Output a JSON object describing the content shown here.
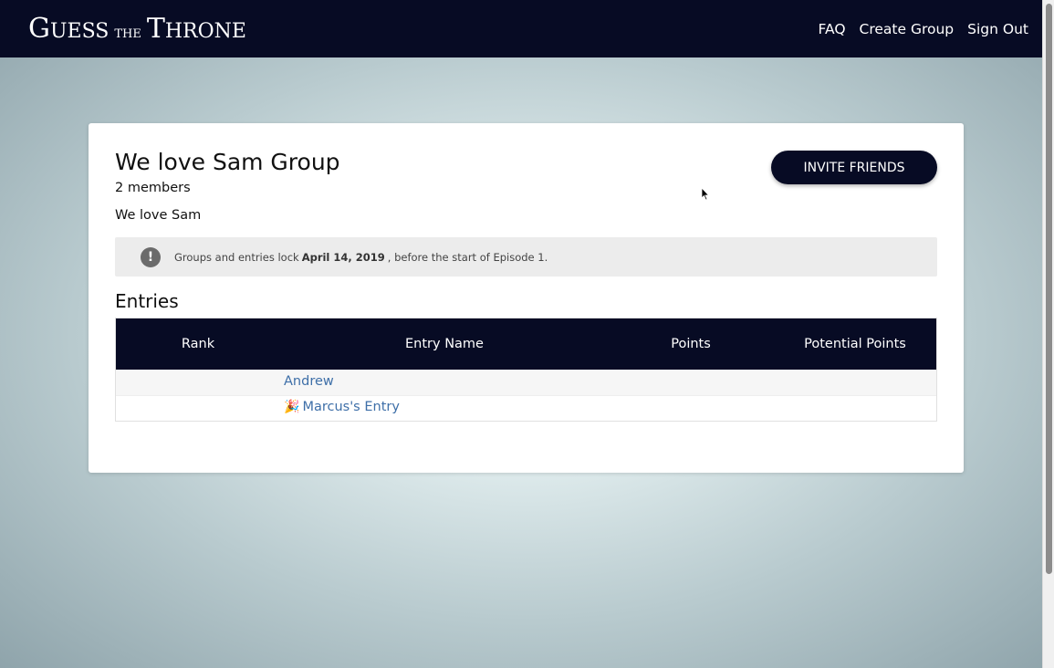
{
  "nav": {
    "logo": {
      "g": "G",
      "uess": "UESS",
      "the": "THE",
      "t": "T",
      "hrone": "HRONE"
    },
    "links": [
      "FAQ",
      "Create Group",
      "Sign Out"
    ]
  },
  "group": {
    "title": "We love Sam Group",
    "members": "2 members",
    "description": "We love Sam",
    "invite_label": "INVITE FRIENDS"
  },
  "notice": {
    "prefix": "Groups and entries lock",
    "date": "April 14, 2019",
    "suffix": ", before the start of Episode 1.",
    "icon": "exclamation-icon"
  },
  "entries": {
    "title": "Entries",
    "columns": [
      "Rank",
      "Entry Name",
      "Points",
      "Potential Points"
    ],
    "rows": [
      {
        "name": "Andrew",
        "icon": ""
      },
      {
        "name": "Marcus's Entry",
        "icon": "🎉"
      }
    ]
  },
  "colors": {
    "navy": "#070b24",
    "link": "#3e6fa8"
  }
}
